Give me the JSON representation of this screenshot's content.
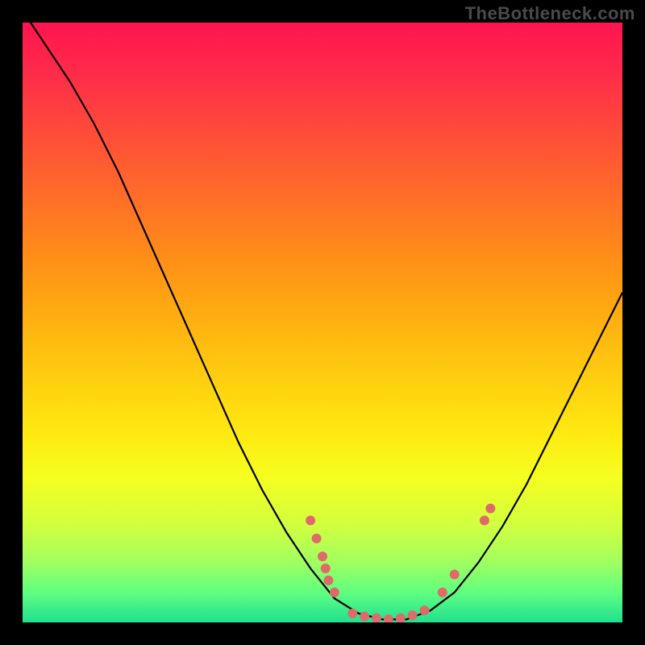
{
  "watermark": "TheBottleneck.com",
  "chart_data": {
    "type": "line",
    "title": "",
    "xlabel": "",
    "ylabel": "",
    "xlim": [
      0,
      100
    ],
    "ylim": [
      0,
      100
    ],
    "curve": [
      {
        "x": 0,
        "y": 102
      },
      {
        "x": 4,
        "y": 96
      },
      {
        "x": 8,
        "y": 90
      },
      {
        "x": 12,
        "y": 83
      },
      {
        "x": 16,
        "y": 75
      },
      {
        "x": 20,
        "y": 66
      },
      {
        "x": 24,
        "y": 57
      },
      {
        "x": 28,
        "y": 48
      },
      {
        "x": 32,
        "y": 39
      },
      {
        "x": 36,
        "y": 30
      },
      {
        "x": 40,
        "y": 22
      },
      {
        "x": 44,
        "y": 15
      },
      {
        "x": 48,
        "y": 9
      },
      {
        "x": 52,
        "y": 4
      },
      {
        "x": 56,
        "y": 1.5
      },
      {
        "x": 60,
        "y": 0.5
      },
      {
        "x": 64,
        "y": 0.5
      },
      {
        "x": 68,
        "y": 2
      },
      {
        "x": 72,
        "y": 5
      },
      {
        "x": 76,
        "y": 10
      },
      {
        "x": 80,
        "y": 16
      },
      {
        "x": 84,
        "y": 23
      },
      {
        "x": 88,
        "y": 31
      },
      {
        "x": 92,
        "y": 39
      },
      {
        "x": 96,
        "y": 47
      },
      {
        "x": 100,
        "y": 55
      }
    ],
    "points_left": [
      {
        "x": 48,
        "y": 17
      },
      {
        "x": 49,
        "y": 14
      },
      {
        "x": 50,
        "y": 11
      },
      {
        "x": 50.5,
        "y": 9
      },
      {
        "x": 51,
        "y": 7
      },
      {
        "x": 52,
        "y": 5
      }
    ],
    "points_bottom": [
      {
        "x": 55,
        "y": 1.5
      },
      {
        "x": 57,
        "y": 1
      },
      {
        "x": 59,
        "y": 0.7
      },
      {
        "x": 61,
        "y": 0.5
      },
      {
        "x": 63,
        "y": 0.7
      },
      {
        "x": 65,
        "y": 1.2
      },
      {
        "x": 67,
        "y": 2
      }
    ],
    "points_right": [
      {
        "x": 70,
        "y": 5
      },
      {
        "x": 72,
        "y": 8
      },
      {
        "x": 77,
        "y": 17
      },
      {
        "x": 78,
        "y": 19
      }
    ]
  }
}
